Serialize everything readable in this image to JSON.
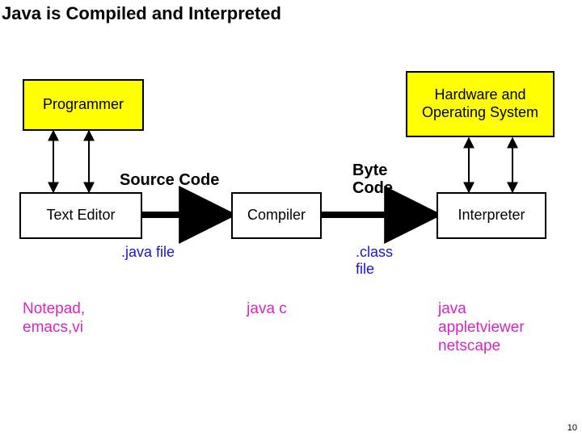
{
  "title": "Java is Compiled and Interpreted",
  "boxes": {
    "programmer": "Programmer",
    "hw_os": "Hardware and Operating System",
    "text_editor": "Text Editor",
    "compiler": "Compiler",
    "interpreter": "Interpreter"
  },
  "flow": {
    "source_code": "Source Code",
    "byte_code": "Byte Code"
  },
  "files": {
    "java_file": ".java file",
    "class_file": ".class file"
  },
  "tools": {
    "editors": "Notepad, emacs,vi",
    "compiler": "java c",
    "runtime": "java appletviewer netscape"
  },
  "page_number": "10"
}
